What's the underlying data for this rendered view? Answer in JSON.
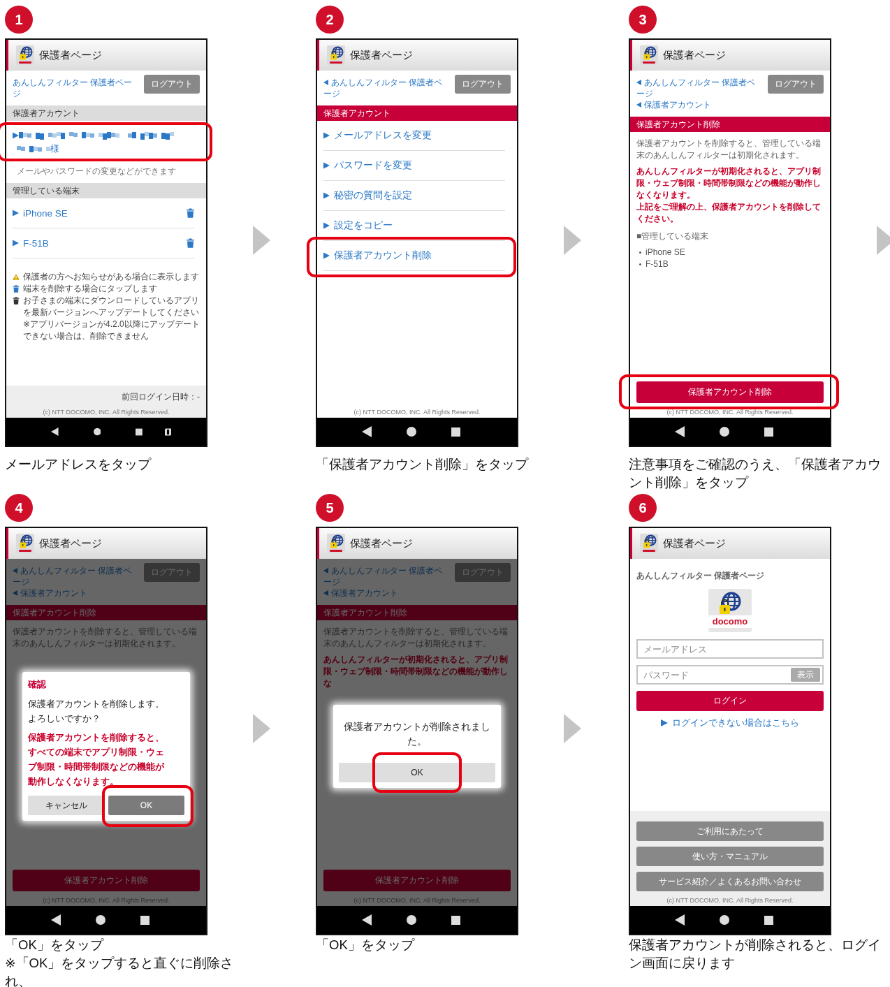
{
  "steps": [
    {
      "number": "1",
      "next_arrow": true,
      "caption": [
        "メールアドレスをタップ"
      ],
      "screen": {
        "title": "保護者ページ",
        "nav_rotate": true,
        "body": [
          {
            "kind": "top_links",
            "links": [
              {
                "text": "あんしんフィルター 保護者ページ"
              }
            ],
            "logout": "ログアウト"
          },
          {
            "kind": "section",
            "text": "保護者アカウント",
            "accent": false
          },
          {
            "kind": "account",
            "text": "様",
            "note": "メールやパスワードの変更などができます",
            "highlighted": true
          },
          {
            "kind": "section",
            "text": "管理している端末",
            "accent": false
          },
          {
            "kind": "link_row",
            "text": "iPhone SE",
            "trash": true
          },
          {
            "kind": "link_row",
            "text": "F-51B",
            "trash": true
          },
          {
            "kind": "legend",
            "items": [
              "保護者の方へお知らせがある場合に表示します",
              "端末を削除する場合にタップします",
              "お子さまの端末にダウンロードしているアプリを最新バージョンへアップデートしてください\n※アプリバージョンが4.2.0以降にアップデートできない場合は、削除できません"
            ]
          }
        ],
        "footer": {
          "shaded": true,
          "items": [
            {
              "kind": "last_login",
              "text": "前回ログイン日時：-"
            }
          ],
          "copyright": "(c) NTT DOCOMO, INC. All Rights Reserved."
        }
      }
    },
    {
      "number": "2",
      "next_arrow": true,
      "caption": [
        "「保護者アカウント削除」をタップ"
      ],
      "screen": {
        "title": "保護者ページ",
        "body": [
          {
            "kind": "top_links",
            "links": [
              {
                "text": "あんしんフィルター 保護者ページ",
                "back": true
              }
            ],
            "logout": "ログアウト"
          },
          {
            "kind": "section",
            "text": "保護者アカウント",
            "accent": true
          },
          {
            "kind": "link_row",
            "text": "メールアドレスを変更"
          },
          {
            "kind": "link_row",
            "text": "パスワードを変更"
          },
          {
            "kind": "link_row",
            "text": "秘密の質問を設定"
          },
          {
            "kind": "link_row",
            "text": "設定をコピー"
          },
          {
            "kind": "link_row",
            "text": "保護者アカウント削除",
            "highlighted": true
          }
        ],
        "footer": {
          "copyright": "(c) NTT DOCOMO, INC. All Rights Reserved."
        }
      }
    },
    {
      "number": "3",
      "next_arrow": true,
      "caption": [
        "注意事項をご確認のうえ、「保護者アカウント削除」をタップ"
      ],
      "screen": {
        "title": "保護者ページ",
        "body": [
          {
            "kind": "top_links",
            "links": [
              {
                "text": "あんしんフィルター 保護者ページ",
                "back": true
              },
              {
                "text": "保護者アカウント",
                "back": true
              }
            ],
            "logout": "ログアウト"
          },
          {
            "kind": "section",
            "text": "保護者アカウント削除",
            "accent": true
          },
          {
            "kind": "text",
            "text": "保護者アカウントを削除すると、管理している端末のあんしんフィルターは初期化されます。"
          },
          {
            "kind": "alert",
            "text": "あんしんフィルターが初期化されると、アプリ制限・ウェブ制限・時間帯制限などの機能が動作しなくなります。"
          },
          {
            "kind": "alert",
            "text": "上記をご理解の上、保護者アカウントを削除してください。"
          },
          {
            "kind": "text",
            "text": "■管理している端末"
          },
          {
            "kind": "bullets",
            "items": [
              "iPhone SE",
              "F-51B"
            ]
          }
        ],
        "footer": {
          "items": [
            {
              "kind": "danger_button",
              "text": "保護者アカウント削除",
              "highlighted": true
            }
          ],
          "copyright": "(c) NTT DOCOMO, INC. All Rights Reserved."
        }
      }
    },
    {
      "number": "4",
      "next_arrow": true,
      "caption": [
        "「OK」をタップ",
        "※「OK」をタップすると直ぐに削除され、"
      ],
      "screen": {
        "title": "保護者ページ",
        "dimmed": true,
        "body": [
          {
            "kind": "top_links",
            "links": [
              {
                "text": "あんしんフィルター 保護者ページ",
                "back": true
              },
              {
                "text": "保護者アカウント",
                "back": true
              }
            ],
            "logout": "ログアウト"
          },
          {
            "kind": "section",
            "text": "保護者アカウント削除",
            "accent": true
          },
          {
            "kind": "text",
            "text": "保護者アカウントを削除すると、管理している端末のあんしんフィルターは初期化されます。"
          }
        ],
        "footer": {
          "items": [
            {
              "kind": "danger_button",
              "text": "保護者アカウント削除"
            }
          ],
          "copyright": "(c) NTT DOCOMO, INC. All Rights Reserved."
        },
        "dialog": {
          "title": "確認",
          "message": "保護者アカウントを削除します。よろしいですか？",
          "warning": "保護者アカウントを削除すると、すべての端末でアプリ制限・ウェブ制限・時間帯制限などの機能が動作しなくなります。",
          "buttons": [
            {
              "label": "キャンセル",
              "primary": false
            },
            {
              "label": "OK",
              "primary": true,
              "highlighted": true
            }
          ]
        }
      }
    },
    {
      "number": "5",
      "next_arrow": true,
      "caption": [
        "「OK」をタップ"
      ],
      "screen": {
        "title": "保護者ページ",
        "dimmed": true,
        "body": [
          {
            "kind": "top_links",
            "links": [
              {
                "text": "あんしんフィルター 保護者ページ",
                "back": true
              },
              {
                "text": "保護者アカウント",
                "back": true
              }
            ],
            "logout": "ログアウト"
          },
          {
            "kind": "section",
            "text": "保護者アカウント削除",
            "accent": true
          },
          {
            "kind": "text",
            "text": "保護者アカウントを削除すると、管理している端末のあんしんフィルターは初期化されます。"
          },
          {
            "kind": "alert",
            "text": "あんしんフィルターが初期化されると、アプリ制限・ウェブ制限・時間帯制限などの機能が動作しな"
          }
        ],
        "footer": {
          "items": [
            {
              "kind": "danger_button",
              "text": "保護者アカウント削除"
            }
          ],
          "copyright": "(c) NTT DOCOMO, INC. All Rights Reserved."
        },
        "dialog": {
          "message": "保護者アカウントが削除されました。",
          "buttons": [
            {
              "label": "OK",
              "primary": false,
              "highlighted": true
            }
          ]
        }
      }
    },
    {
      "number": "6",
      "caption": [
        "保護者アカウントが削除されると、ログイン画面に戻ります"
      ],
      "screen": {
        "title": "保護者ページ",
        "body": [
          {
            "kind": "heading",
            "text": "あんしんフィルター 保護者ページ"
          },
          {
            "kind": "logo",
            "text": "docomo"
          },
          {
            "kind": "input",
            "placeholder": "メールアドレス"
          },
          {
            "kind": "password",
            "placeholder": "パスワード",
            "button": "表示"
          },
          {
            "kind": "primary_button",
            "text": "ログイン"
          },
          {
            "kind": "center_link",
            "text": "ログインできない場合はこちら"
          }
        ],
        "footer": {
          "shaded": true,
          "items": [
            {
              "kind": "gray_button",
              "text": "ご利用にあたって"
            },
            {
              "kind": "gray_button",
              "text": "使い方・マニュアル"
            },
            {
              "kind": "gray_button",
              "text": "サービス紹介／よくあるお問い合わせ"
            }
          ],
          "copyright": "(c) NTT DOCOMO, INC. All Rights Reserved."
        }
      }
    }
  ]
}
